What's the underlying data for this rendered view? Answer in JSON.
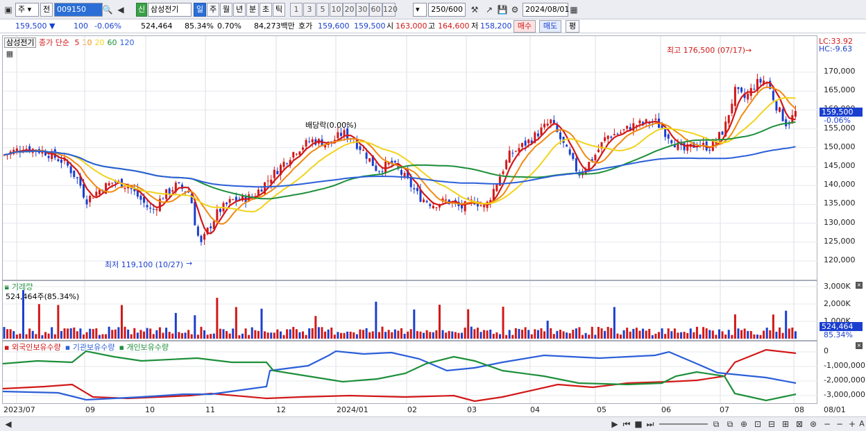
{
  "toolbar": {
    "period_prefix": "주",
    "prev_label": "전",
    "code": "009150",
    "stock_badge": "신",
    "stock_name": "삼성전기",
    "periods": [
      "일",
      "주",
      "월",
      "년",
      "분",
      "초",
      "틱"
    ],
    "intervals": [
      "1",
      "3",
      "5",
      "10",
      "20",
      "30",
      "60",
      "120"
    ],
    "count": "250",
    "max_count": "/600",
    "date": "2024/08/01"
  },
  "quote": {
    "price": "159,500",
    "arrow": "▼",
    "change": "100",
    "change_pct": "-0.06%",
    "volume": "524,464",
    "vol_ratio": "85.34%",
    "turnover": "0.70%",
    "amount": "84,273백만",
    "ask_label": "호가",
    "ask": "159,600",
    "bid": "159,500",
    "open_label": "시",
    "open": "163,000",
    "high_label": "고",
    "high": "164,600",
    "low_label": "저",
    "low": "158,200",
    "buy": "매수",
    "sell": "매도",
    "flat": "평"
  },
  "price_panel": {
    "title": "삼성전기",
    "ma_label": "종가 단순",
    "ma": [
      {
        "p": "5",
        "color": "#d21818"
      },
      {
        "p": "10",
        "color": "#f08a10"
      },
      {
        "p": "20",
        "color": "#f2d31b"
      },
      {
        "p": "60",
        "color": "#1d8f3a"
      },
      {
        "p": "120",
        "color": "#2b5fd9"
      }
    ],
    "lc": "LC:33.92",
    "hc": "HC:-9.63",
    "high_note": "최고 176,500 (07/17)",
    "low_note": "최저 119,100 (10/27)",
    "div_note": "배당락(0.00%)",
    "cur_price": "159,500",
    "cur_pct": "-0.06%",
    "yticks": [
      "170,000",
      "165,000",
      "160,000",
      "155,000",
      "150,000",
      "145,000",
      "140,000",
      "135,000",
      "130,000",
      "125,000",
      "120,000"
    ]
  },
  "volume_panel": {
    "title": "거래량",
    "value": "524,464주(85.34%)",
    "yticks": [
      "3,000K",
      "2,000K",
      "1,000K"
    ],
    "cur_vol": "524,464",
    "cur_pct": "85.34%"
  },
  "holdings_panel": {
    "legend": [
      {
        "label": "외국인보유수량",
        "color": "#d21818"
      },
      {
        "label": "기관보유수량",
        "color": "#2b5fd9"
      },
      {
        "label": "개인보유수량",
        "color": "#1d8f3a"
      }
    ],
    "yticks": [
      "0",
      "-1,000,000",
      "-2,000,000",
      "-3,000,000"
    ]
  },
  "xaxis": [
    "2023/07",
    "09",
    "10",
    "11",
    "12",
    "2024/01",
    "02",
    "03",
    "04",
    "05",
    "06",
    "07",
    "08",
    "08/01"
  ],
  "chart_data": {
    "type": "candlestick",
    "ylim": [
      117000,
      176500
    ]
  }
}
